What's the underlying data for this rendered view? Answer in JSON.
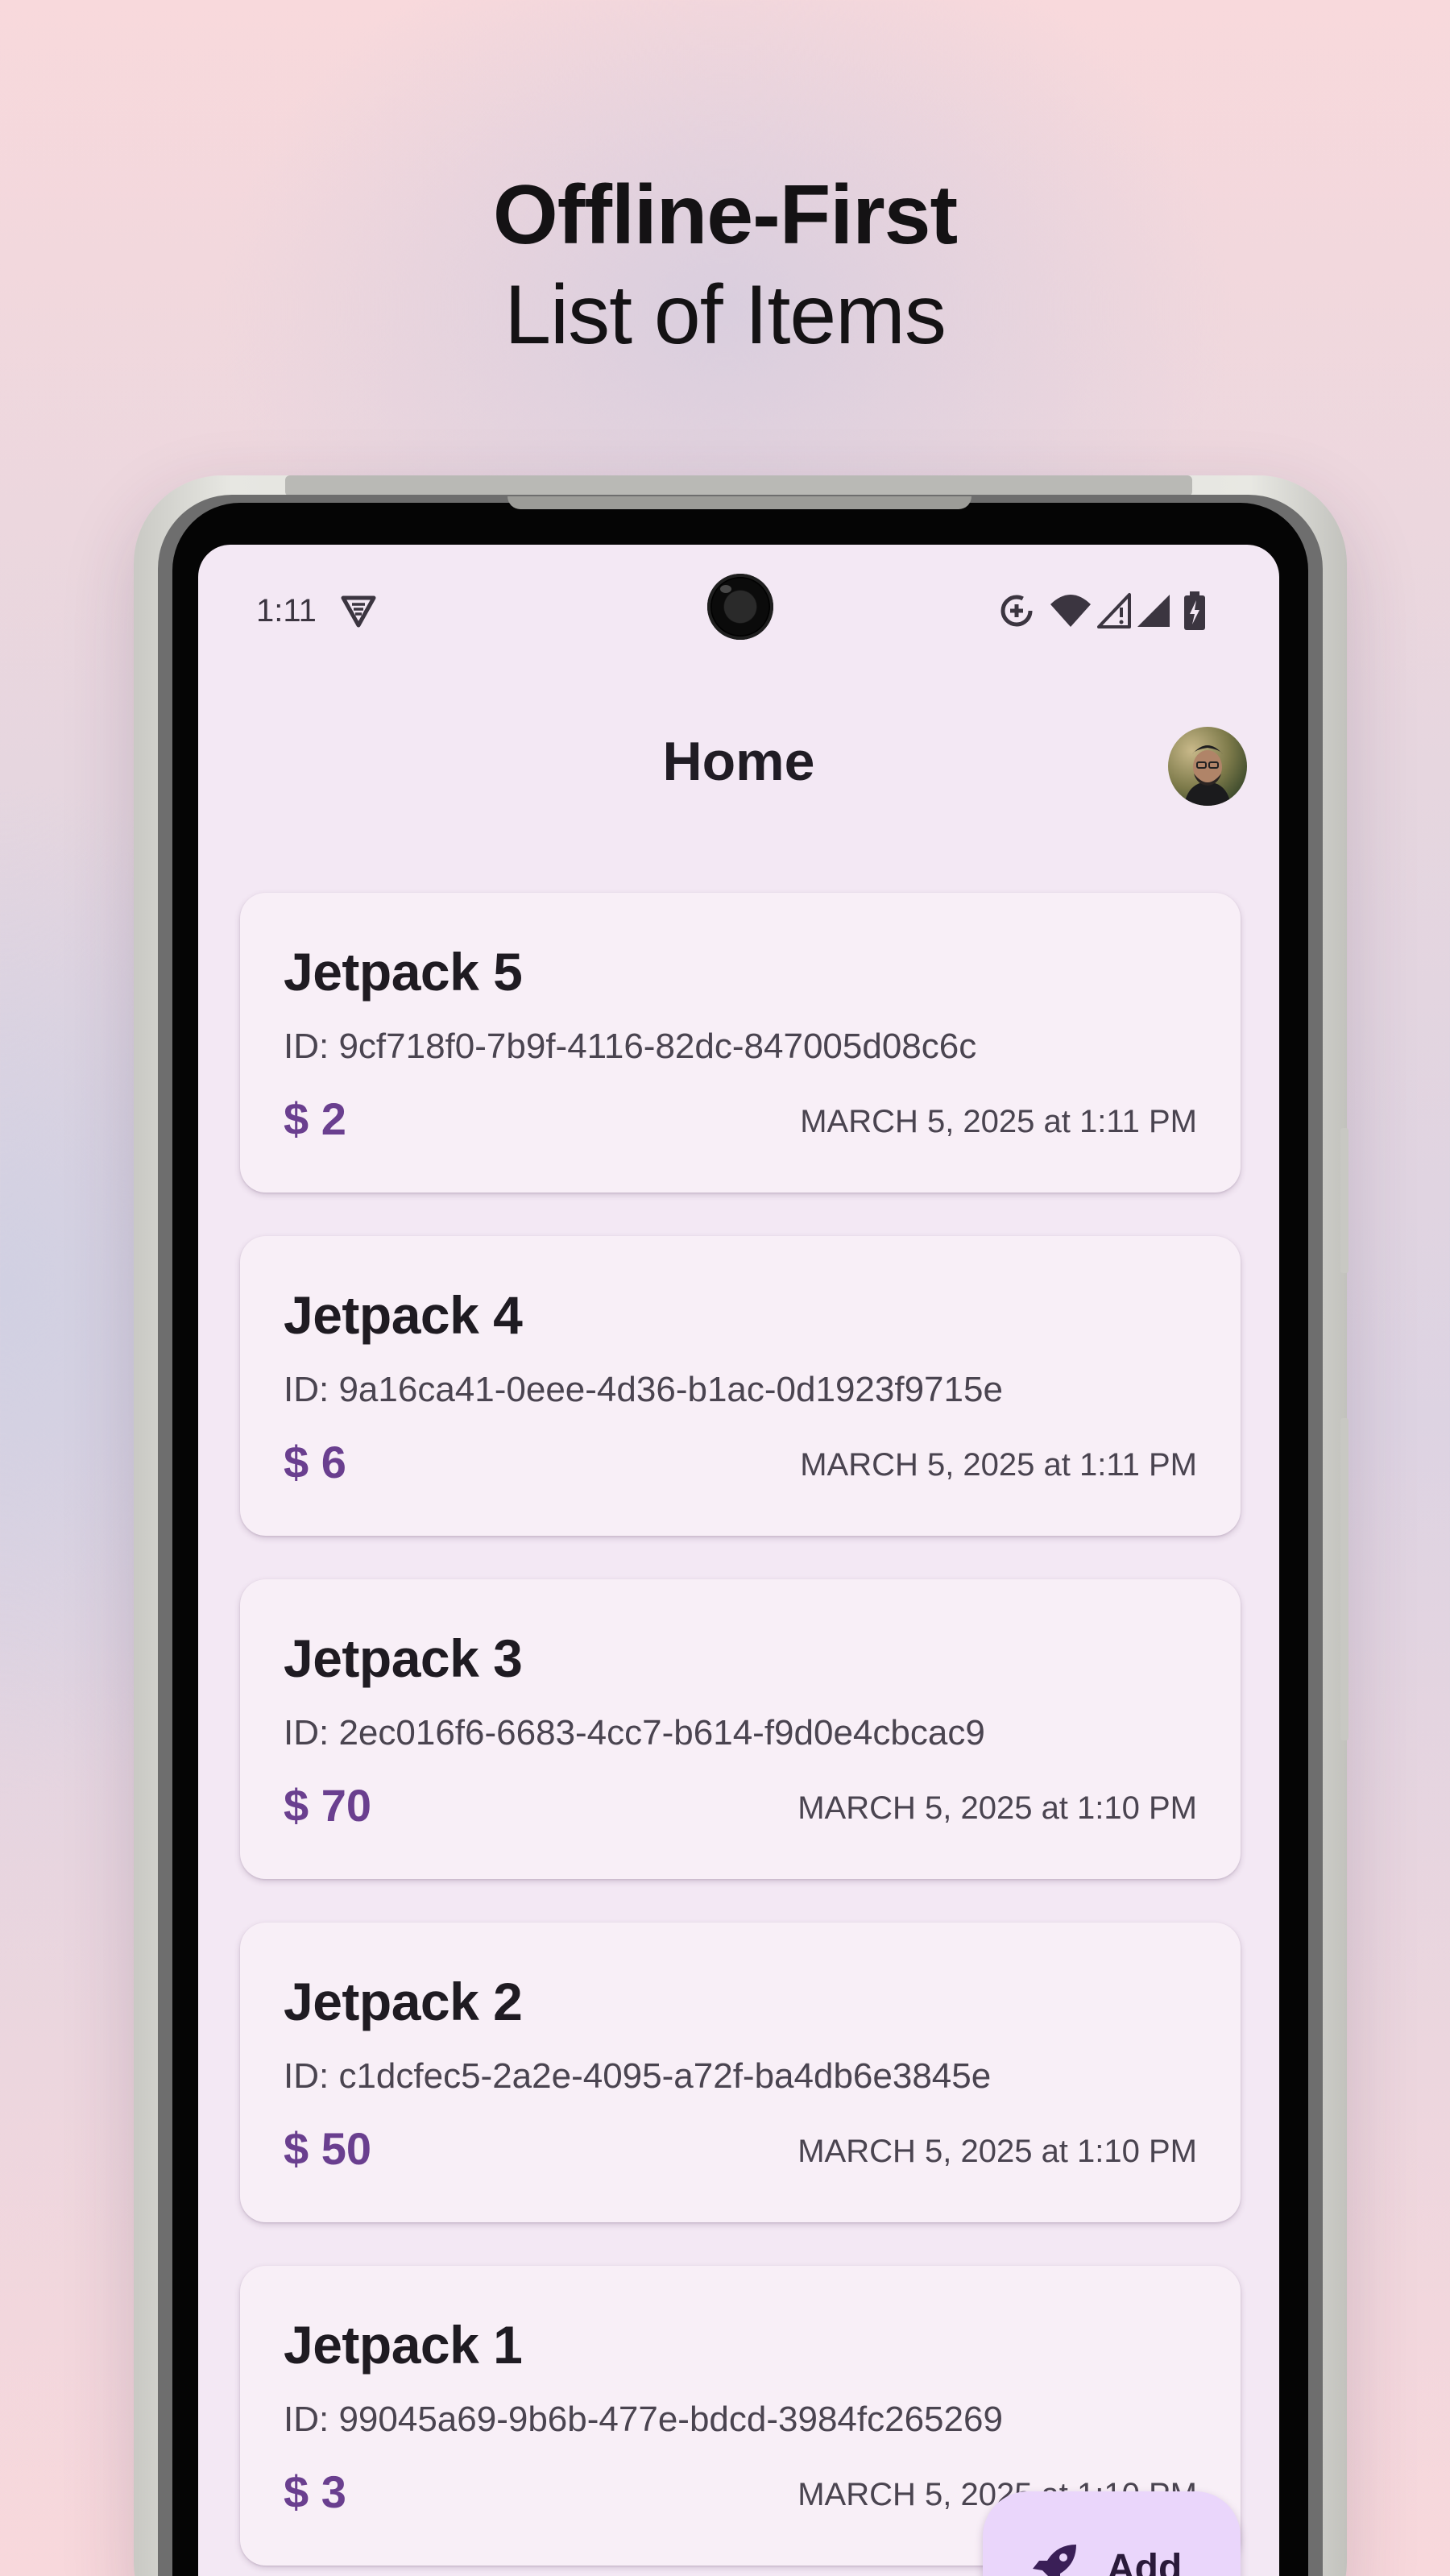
{
  "promo": {
    "headline": "Offline-First",
    "subheadline": "List of Items"
  },
  "status_bar": {
    "time": "1:11",
    "icons": [
      "vpn-icon",
      "data-saver-icon",
      "wifi-icon",
      "signal-icon",
      "signal-icon",
      "battery-charging-icon"
    ]
  },
  "app_bar": {
    "title": "Home",
    "avatar": "profile-avatar"
  },
  "items": [
    {
      "name": "Jetpack 5",
      "id": "ID: 9cf718f0-7b9f-4116-82dc-847005d08c6c",
      "price": "$ 2",
      "date": "MARCH 5, 2025 at 1:11 PM"
    },
    {
      "name": "Jetpack 4",
      "id": "ID: 9a16ca41-0eee-4d36-b1ac-0d1923f9715e",
      "price": "$ 6",
      "date": "MARCH 5, 2025 at 1:11 PM"
    },
    {
      "name": "Jetpack 3",
      "id": "ID: 2ec016f6-6683-4cc7-b614-f9d0e4cbcac9",
      "price": "$ 70",
      "date": "MARCH 5, 2025 at 1:10 PM"
    },
    {
      "name": "Jetpack 2",
      "id": "ID: c1dcfec5-2a2e-4095-a72f-ba4db6e3845e",
      "price": "$ 50",
      "date": "MARCH 5, 2025 at 1:10 PM"
    },
    {
      "name": "Jetpack 1",
      "id": "ID: 99045a69-9b6b-477e-bdcd-3984fc265269",
      "price": "$ 3",
      "date": "MARCH 5, 2025 at 1:10 PM"
    }
  ],
  "fab": {
    "label": "Add",
    "icon": "rocket-icon"
  },
  "colors": {
    "accent_price": "#6a3f8f",
    "card_background": "#f8eff7",
    "screen_background": "#f3e8f4",
    "fab_background": "#ead6fb"
  }
}
